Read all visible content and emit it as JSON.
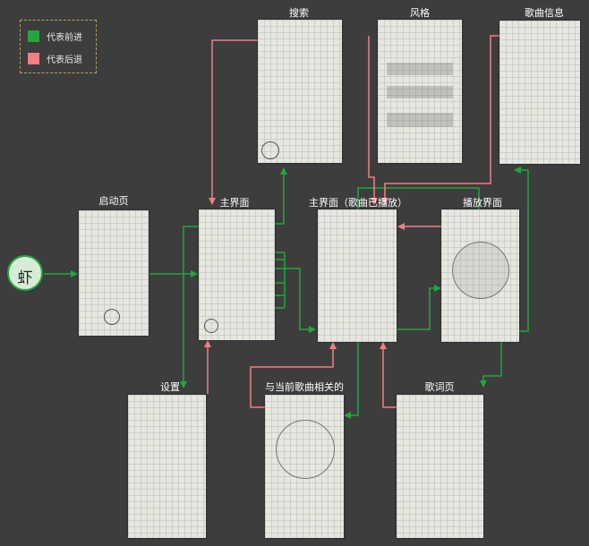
{
  "legend": {
    "forward": {
      "label": "代表前进",
      "color": "#23a63d"
    },
    "back": {
      "label": "代表后退",
      "color": "#f07f86"
    }
  },
  "app_logo": {
    "text": "虾"
  },
  "screens": {
    "launch": {
      "label": "启动页"
    },
    "main": {
      "label": "主界面"
    },
    "search": {
      "label": "搜索"
    },
    "style": {
      "label": "风格"
    },
    "song_info": {
      "label": "歌曲信息"
    },
    "main_playing": {
      "label": "主界面（歌曲已播放）"
    },
    "player": {
      "label": "播放界面"
    },
    "settings": {
      "label": "设置"
    },
    "related": {
      "label": "与当前歌曲相关的"
    },
    "lyrics": {
      "label": "歌词页"
    }
  },
  "colors": {
    "background": "#3d3d3d",
    "paper": "#e8e6e0",
    "forward": "#23a63d",
    "back": "#f07f86"
  }
}
